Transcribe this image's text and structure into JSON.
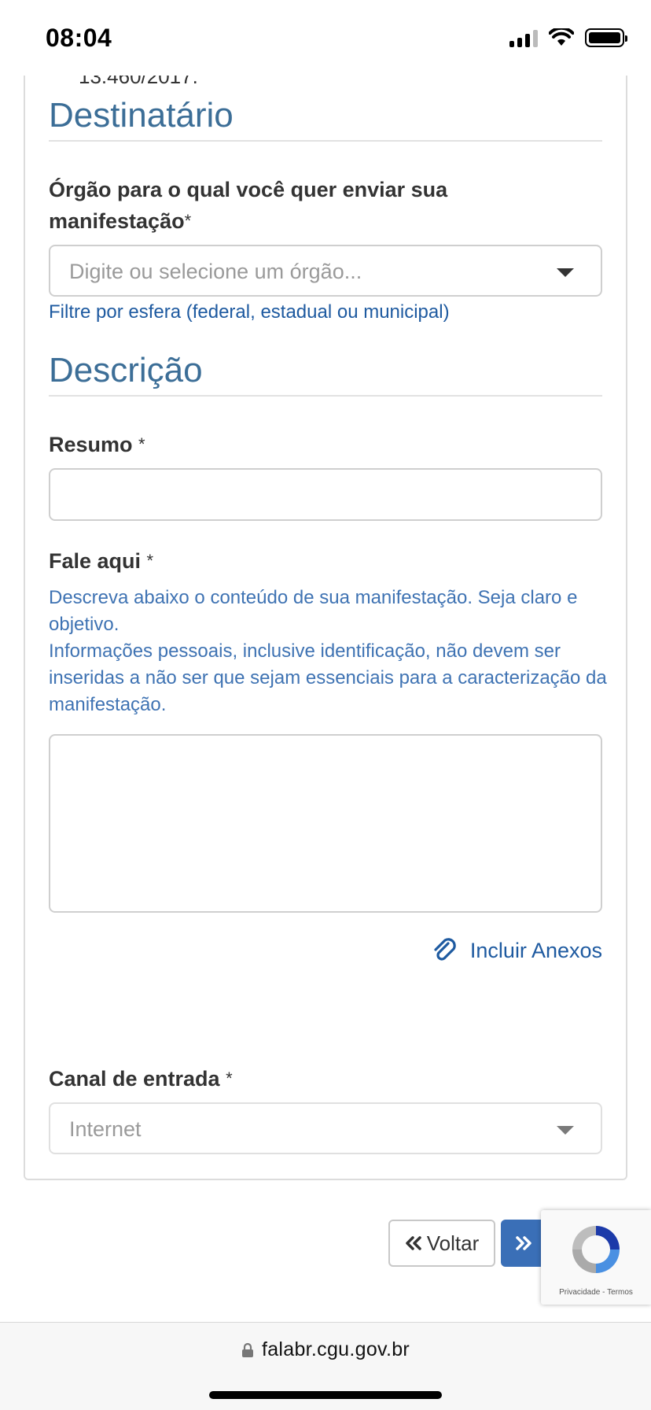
{
  "status_bar": {
    "time": "08:04"
  },
  "clipped_text": "13.460/2017.",
  "destinatario": {
    "title": "Destinatário",
    "orgao_label": "Órgão para o qual você quer enviar sua manifestação",
    "orgao_required": "*",
    "orgao_placeholder": "Digite ou selecione um órgão...",
    "filter_link": "Filtre por esfera (federal, estadual ou municipal)"
  },
  "descricao": {
    "title": "Descrição",
    "resumo_label": "Resumo",
    "resumo_required": "*",
    "resumo_value": "",
    "fale_label": "Fale aqui",
    "fale_required": "*",
    "fale_help_1": "Descreva abaixo o conteúdo de sua manifestação. Seja claro e objetivo.",
    "fale_help_2": "Informações pessoais, inclusive identificação, não devem ser inseridas a não ser que sejam essenciais para a caracterização da manifestação.",
    "fale_value": "",
    "attach_label": "Incluir Anexos"
  },
  "canal": {
    "label": "Canal de entrada",
    "required": "*",
    "value": "Internet"
  },
  "buttons": {
    "back_label": "Voltar"
  },
  "recaptcha": {
    "privacy": "Privacidade",
    "separator": "-",
    "terms": "Termos"
  },
  "browser": {
    "url": "falabr.cgu.gov.br"
  },
  "colors": {
    "accent": "#3a6fb7",
    "section_title": "#3c6e97",
    "help_text": "#3f73b3"
  }
}
